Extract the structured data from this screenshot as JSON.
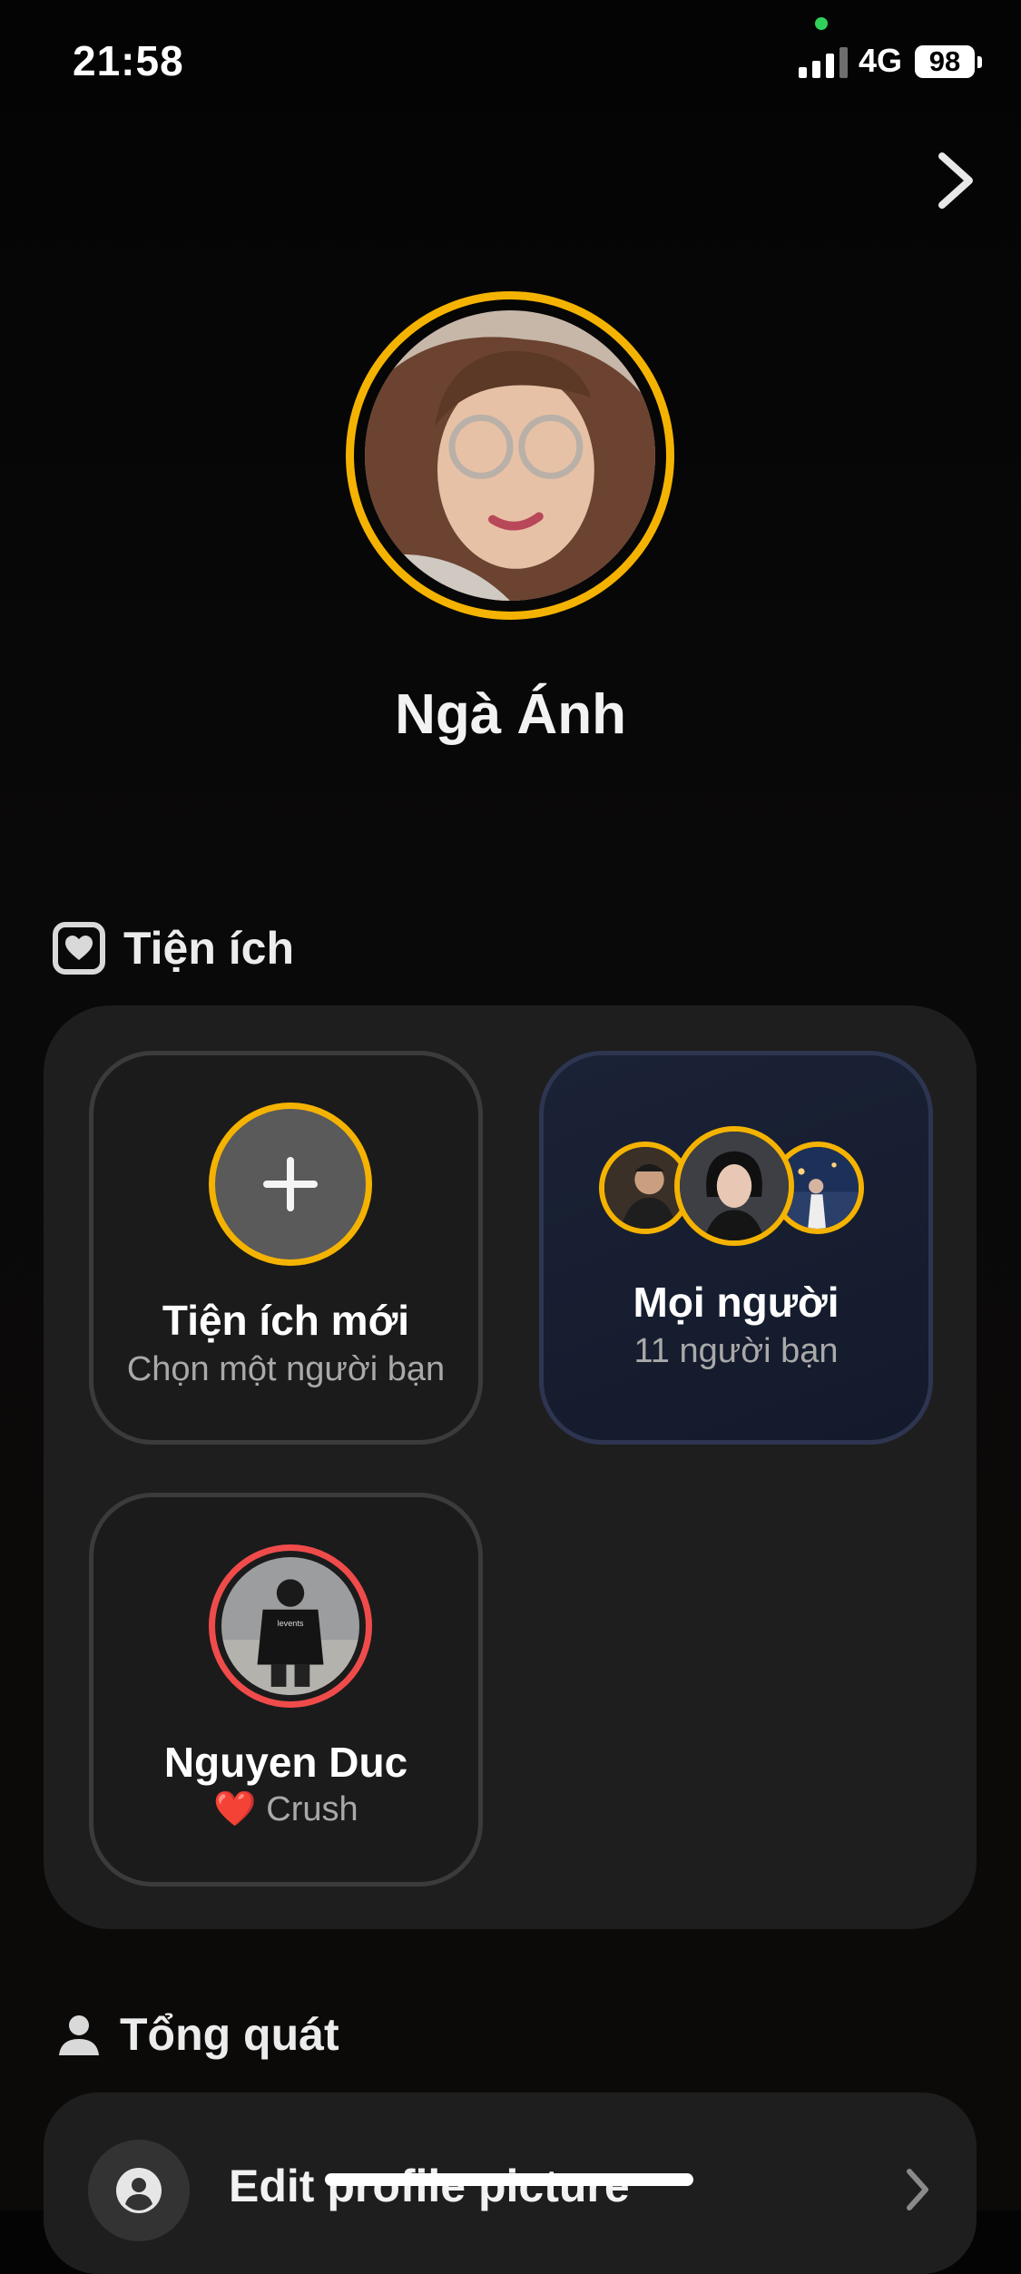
{
  "status_bar": {
    "time": "21:58",
    "network": "4G",
    "battery": "98"
  },
  "profile": {
    "name": "Ngà Ánh"
  },
  "widgets_section": {
    "title": "Tiện ích",
    "new_widget": {
      "title": "Tiện ích mới",
      "subtitle": "Chọn một người bạn"
    },
    "everyone_widget": {
      "title": "Mọi người",
      "subtitle": "11 người bạn"
    },
    "friend_widget": {
      "title": "Nguyen Duc",
      "emoji": "❤️",
      "subtitle": "Crush",
      "shirt_text": "levents"
    }
  },
  "general_section": {
    "title": "Tổng quát",
    "items": [
      {
        "label": "Edit profile picture"
      }
    ]
  },
  "colors": {
    "accent": "#f5b301",
    "crush_ring": "#f04b4b",
    "online_dot": "#30d158"
  },
  "icons": [
    "signal-icon",
    "battery-icon",
    "chevron-right-icon",
    "heart-widget-icon",
    "plus-icon",
    "person-icon",
    "user-circle-icon"
  ]
}
